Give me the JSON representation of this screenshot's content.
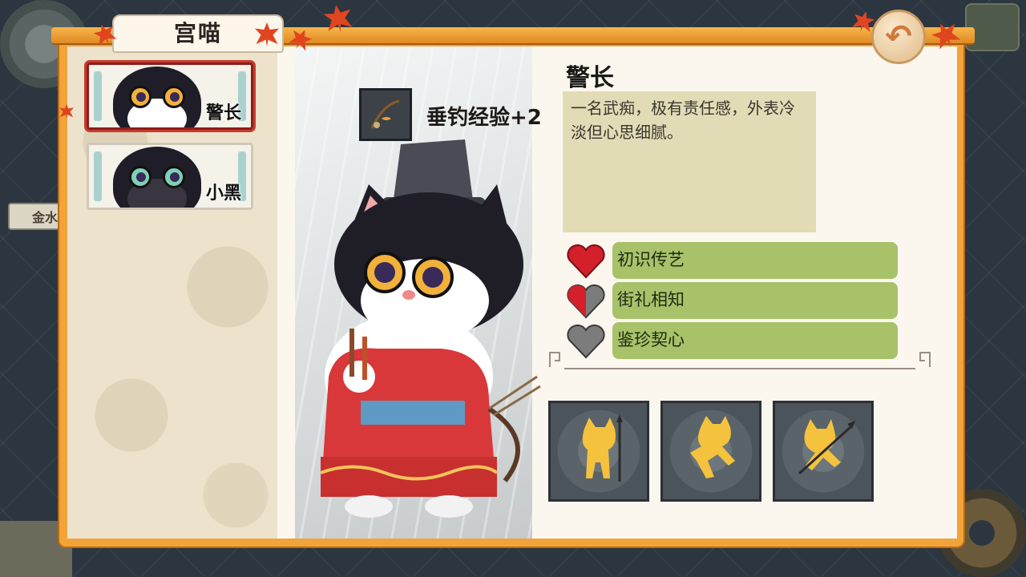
{
  "header": {
    "title": "宫喵"
  },
  "cat_list": [
    {
      "name": "警长",
      "selected": true
    },
    {
      "name": "小黑",
      "selected": false
    }
  ],
  "background": {
    "tag_label": "金水"
  },
  "skill": {
    "icon": "fishing-rod-icon",
    "text": "垂钓经验+2"
  },
  "character": {
    "name": "警长",
    "description": "一名武痴，极有责任感，外表冷淡但心思细腻。"
  },
  "bonds": [
    {
      "label": "初识传艺",
      "heart_fill": 1.0
    },
    {
      "label": "街礼相知",
      "heart_fill": 0.5
    },
    {
      "label": "鉴珍契心",
      "heart_fill": 0.0
    }
  ],
  "poses": [
    "cat-spear-stand-icon",
    "cat-lunge-icon",
    "cat-spear-run-icon"
  ],
  "colors": {
    "frame_orange": "#f2a339",
    "selected_border": "#8f1c1c",
    "bond_green": "#a8c26a",
    "heart_red": "#d3202a",
    "heart_gray": "#7c7c7c",
    "desc_bg": "#e1dcb6"
  }
}
